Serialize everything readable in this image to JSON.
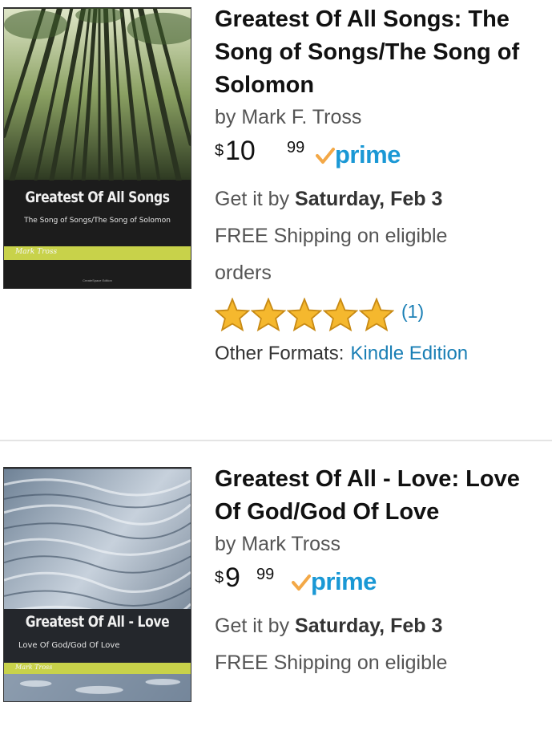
{
  "listings": [
    {
      "cover": {
        "title": "Greatest Of All Songs",
        "subtitle": "The Song of Songs/The Song of Solomon",
        "author": "Mark Tross",
        "imprint": "CreateSpace Edition",
        "band_color": "#c8d24a"
      },
      "title": "Greatest Of All Songs: The Song of Songs/The Song of Solomon",
      "byline": "by Mark F. Tross",
      "price": {
        "symbol": "$",
        "dollars": "10",
        "cents": "99"
      },
      "prime_label": "prime",
      "delivery_prefix": "Get it by ",
      "delivery_date": "Saturday, Feb 3",
      "shipping": "FREE Shipping on eligible",
      "shipping_cont": "orders",
      "rating": {
        "stars": 5,
        "count": "(1)"
      },
      "formats_label": "Other Formats:",
      "formats_link": "Kindle Edition"
    },
    {
      "cover": {
        "title": "Greatest Of All - Love",
        "subtitle": "Love Of God/God Of Love",
        "author": "Mark Tross",
        "band_color": "#c8d24a"
      },
      "title": "Greatest Of All - Love: Love Of God/God Of Love",
      "byline": "by Mark Tross",
      "price": {
        "symbol": "$",
        "dollars": "9",
        "cents": "99"
      },
      "prime_label": "prime",
      "delivery_prefix": "Get it by ",
      "delivery_date": "Saturday, Feb 3",
      "shipping": "FREE Shipping on eligible"
    }
  ],
  "colors": {
    "link": "#1a7fb5",
    "prime_blue": "#1a98d5",
    "prime_check": "#f3a847",
    "star": "#f5b82e"
  },
  "icons": [
    "prime-check-icon",
    "star-icon"
  ]
}
